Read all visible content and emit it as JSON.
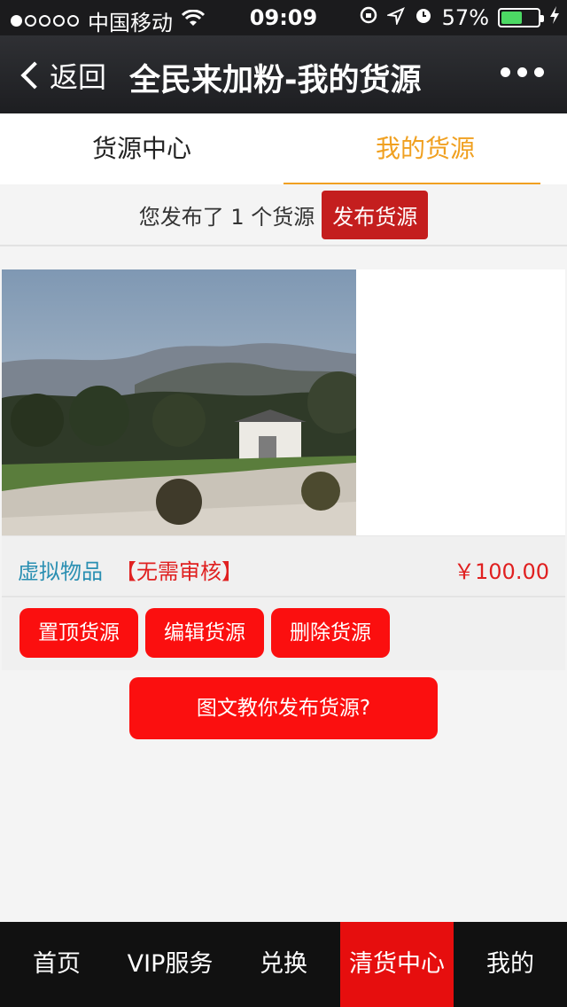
{
  "status": {
    "carrier": "中国移动",
    "time": "09:09",
    "battery": "57%",
    "battery_level": 0.57
  },
  "nav": {
    "back_label": "返回",
    "title": "全民来加粉-我的货源"
  },
  "tabs": [
    {
      "label": "货源中心"
    },
    {
      "label": "我的货源"
    }
  ],
  "publish": {
    "count_text": "您发布了 1 个货源",
    "button_label": "发布货源"
  },
  "item": {
    "category": "虚拟物品",
    "review": "【无需审核】",
    "price": "￥100.00",
    "actions": [
      {
        "label": "置顶货源"
      },
      {
        "label": "编辑货源"
      },
      {
        "label": "删除货源"
      }
    ]
  },
  "tutorial_label": "图文教你发布货源?",
  "bottom_tabs": [
    {
      "label": "首页"
    },
    {
      "label": "VIP服务"
    },
    {
      "label": "兑换"
    },
    {
      "label": "清货中心"
    },
    {
      "label": "我的"
    }
  ],
  "colors": {
    "accent": "#f0a020",
    "red": "#fb0f0f",
    "dark": "#1d1e21"
  }
}
